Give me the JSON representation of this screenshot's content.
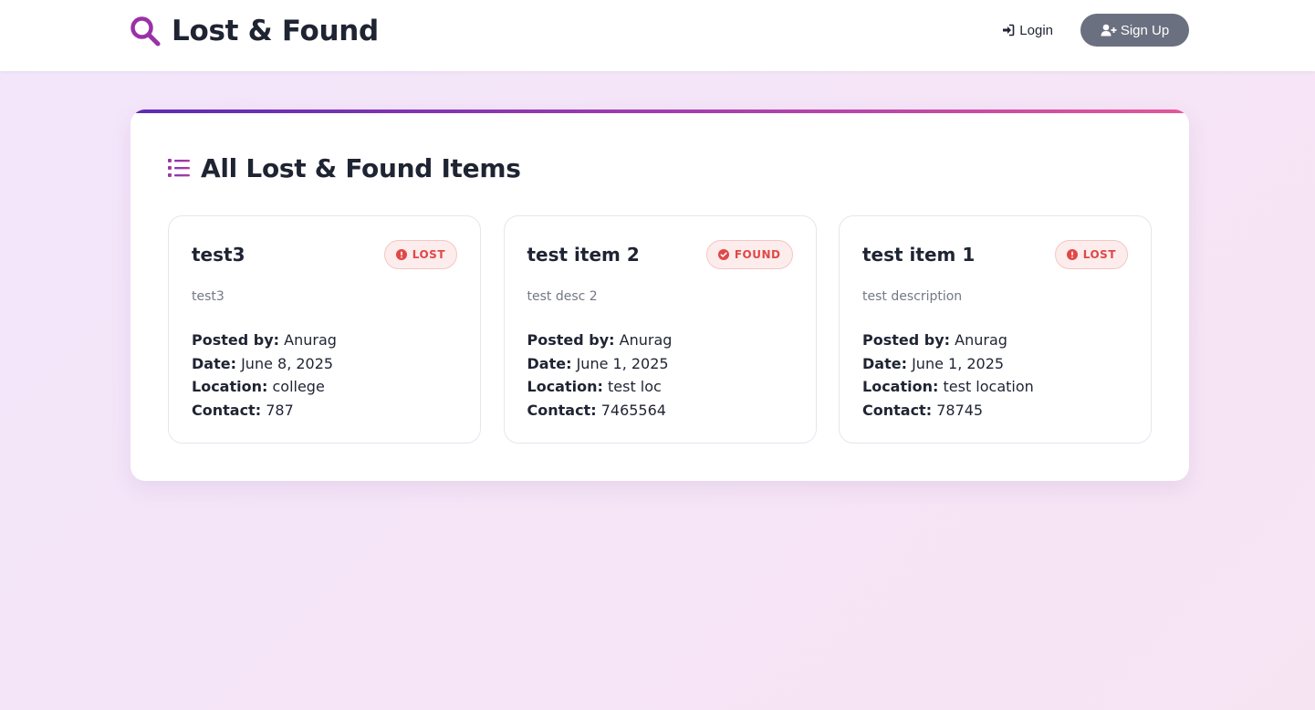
{
  "header": {
    "brand": "Lost & Found",
    "login_label": "Login",
    "signup_label": "Sign Up"
  },
  "panel": {
    "title": "All Lost & Found Items"
  },
  "labels": {
    "posted_by": "Posted by:",
    "date": "Date:",
    "location": "Location:",
    "contact": "Contact:"
  },
  "items": [
    {
      "title": "test3",
      "status": "LOST",
      "description": "test3",
      "posted_by": "Anurag",
      "date": "June 8, 2025",
      "location": "college",
      "contact": "787"
    },
    {
      "title": "test item 2",
      "status": "FOUND",
      "description": "test desc 2",
      "posted_by": "Anurag",
      "date": "June 1, 2025",
      "location": "test loc",
      "contact": "7465564"
    },
    {
      "title": "test item 1",
      "status": "LOST",
      "description": "test description",
      "posted_by": "Anurag",
      "date": "June 1, 2025",
      "location": "test location",
      "contact": "78745"
    }
  ],
  "colors": {
    "brand_purple": "#9b30a8",
    "status_red": "#e04848",
    "badge_bg": "#fdecec",
    "signup_bg": "#6b7080",
    "accent_start": "#5b2bb5",
    "accent_end": "#e3589a"
  },
  "icons": {
    "brand": "search-icon",
    "login": "sign-in-icon",
    "signup": "user-plus-icon",
    "panel": "list-icon",
    "lost": "exclamation-circle-icon",
    "found": "check-circle-icon"
  }
}
